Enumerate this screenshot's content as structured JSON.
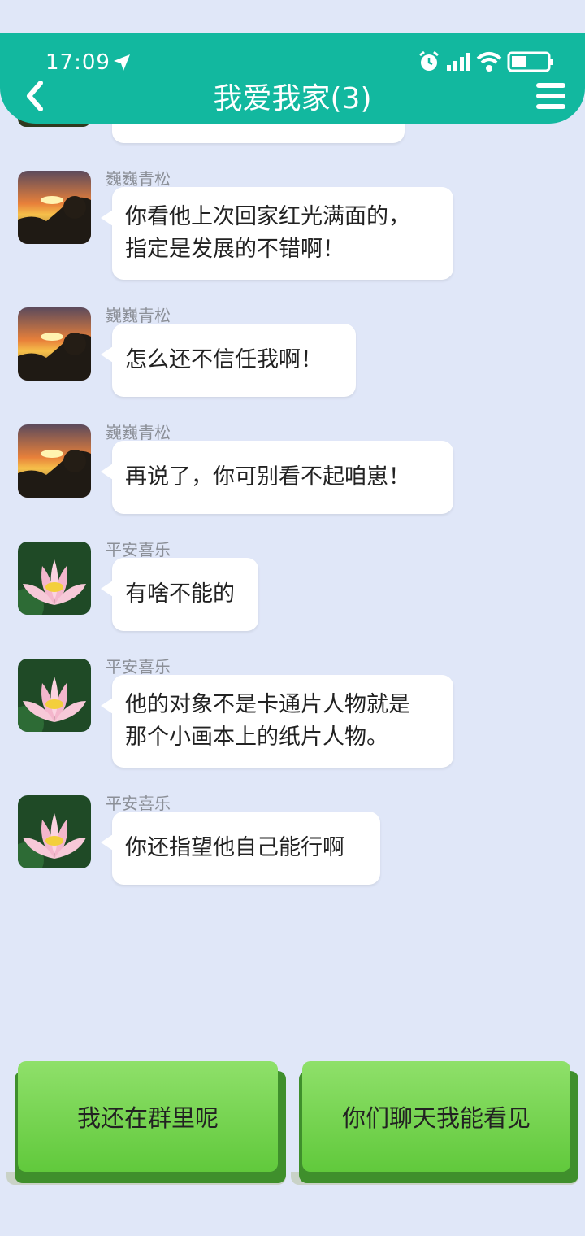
{
  "status_bar": {
    "time": "17:09"
  },
  "header": {
    "title": "我爱我家(3)"
  },
  "messages": [
    {
      "sender": "巍巍青松",
      "lines": [
        "你看他上次回家红光满面的，",
        "指定是发展的不错啊！"
      ],
      "avatar": "sunset-avatar"
    },
    {
      "sender": "巍巍青松",
      "lines": [
        "怎么还不信任我啊！"
      ],
      "avatar": "sunset-avatar"
    },
    {
      "sender": "巍巍青松",
      "lines": [
        "再说了，你可别看不起咱崽！"
      ],
      "avatar": "sunset-avatar"
    },
    {
      "sender": "平安喜乐",
      "lines": [
        "有啥不能的"
      ],
      "avatar": "lotus-avatar"
    },
    {
      "sender": "平安喜乐",
      "lines": [
        "他的对象不是卡通片人物就是",
        "那个小画本上的纸片人物。"
      ],
      "avatar": "lotus-avatar"
    },
    {
      "sender": "平安喜乐",
      "lines": [
        "你还指望他自己能行啊"
      ],
      "avatar": "lotus-avatar"
    }
  ],
  "reply_options": [
    {
      "label": "我还在群里呢"
    },
    {
      "label": "你们聊天我能看见"
    }
  ],
  "colors": {
    "header": "#12b89f",
    "background": "#e0e7f8",
    "button": "#6dd046"
  }
}
